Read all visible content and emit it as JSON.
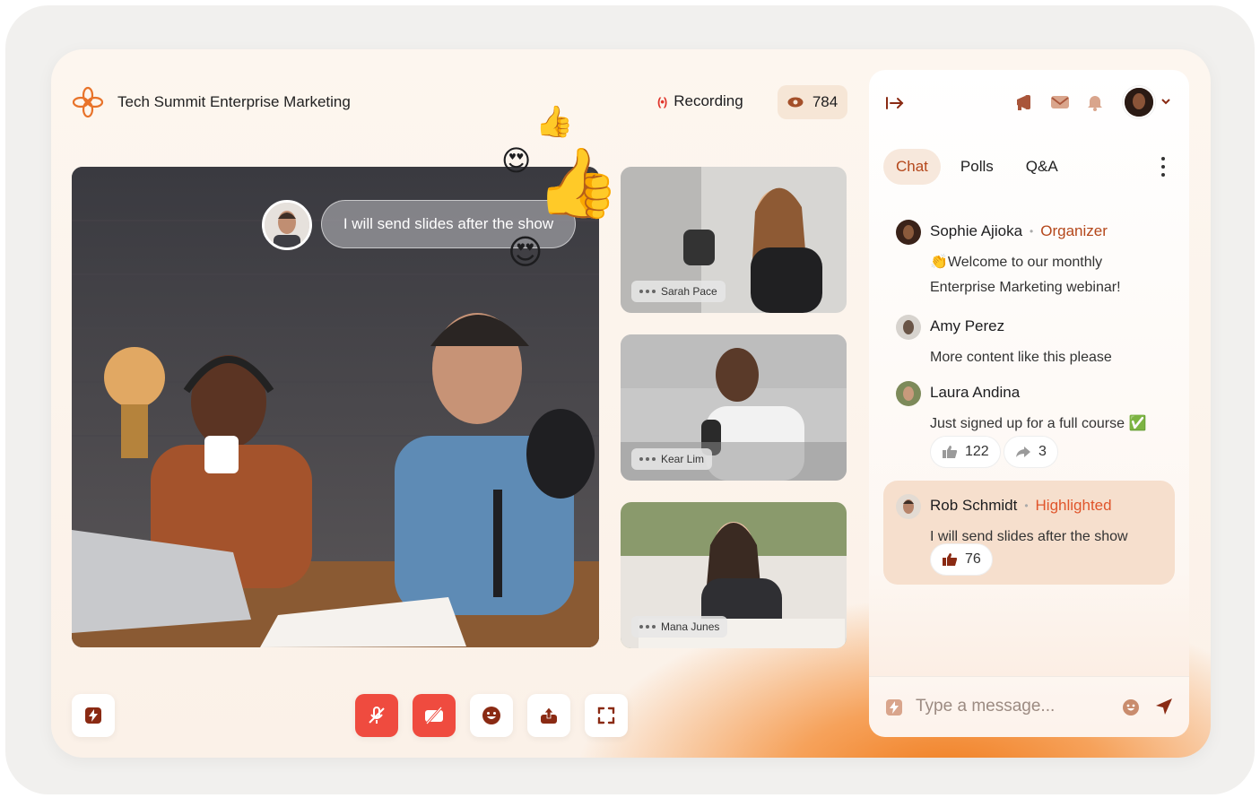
{
  "app": {
    "title": "Tech Summit Enterprise Marketing",
    "recording_label": "Recording",
    "viewer_count": "784"
  },
  "stage": {
    "speech_bubble": "I will send slides after the show",
    "participants": [
      {
        "name": "Sarah Pace"
      },
      {
        "name": "Kear Lim"
      },
      {
        "name": "Mana Junes"
      }
    ]
  },
  "controls": [
    "flash-button",
    "mute-mic-button",
    "camera-off-button",
    "emoji-button",
    "share-button",
    "fullscreen-button"
  ],
  "panel": {
    "tabs": [
      {
        "label": "Chat",
        "active": true
      },
      {
        "label": "Polls",
        "active": false
      },
      {
        "label": "Q&A",
        "active": false
      }
    ],
    "messages": [
      {
        "author": "Sophie Ajioka",
        "tag": "Organizer",
        "text": "👏Welcome to our monthly Enterprise Marketing webinar!"
      },
      {
        "author": "Amy Perez",
        "tag": "",
        "text": "More content like this please"
      },
      {
        "author": "Laura Andina",
        "tag": "",
        "text": "Just signed up for a full course ✅",
        "likes": "122",
        "shares": "3"
      },
      {
        "author": "Rob Schmidt",
        "tag": "Highlighted",
        "text": "I will send slides after the show",
        "likes": "76"
      }
    ],
    "composer_placeholder": "Type a message..."
  },
  "colors": {
    "accent": "#b4471b",
    "danger": "#ef4b3f",
    "recording": "#e0352b"
  }
}
